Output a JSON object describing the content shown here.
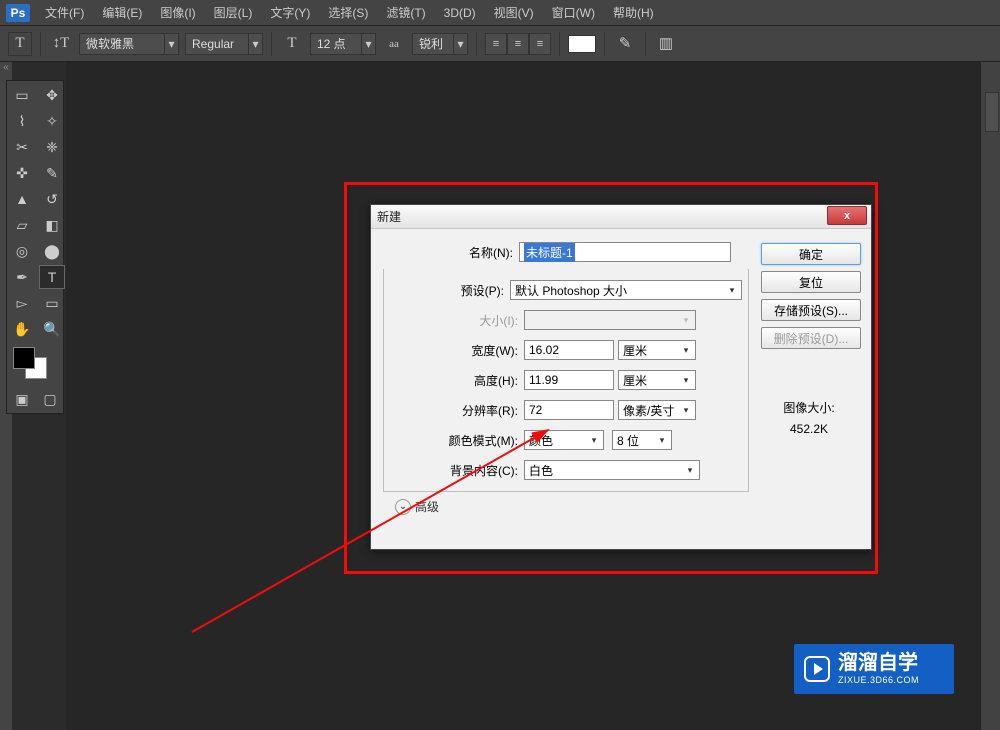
{
  "app": {
    "logo": "Ps"
  },
  "menu": [
    "文件(F)",
    "编辑(E)",
    "图像(I)",
    "图层(L)",
    "文字(Y)",
    "选择(S)",
    "滤镜(T)",
    "3D(D)",
    "视图(V)",
    "窗口(W)",
    "帮助(H)"
  ],
  "options": {
    "font_family": "微软雅黑",
    "font_style": "Regular",
    "font_size": "12 点",
    "aa_label": "aa",
    "aa_value": "锐利"
  },
  "dialog": {
    "title": "新建",
    "close": "x",
    "name_label": "名称(N):",
    "name_value": "未标题-1",
    "preset_label": "预设(P):",
    "preset_value": "默认 Photoshop 大小",
    "size_label": "大小(I):",
    "width_label": "宽度(W):",
    "width_value": "16.02",
    "width_unit": "厘米",
    "height_label": "高度(H):",
    "height_value": "11.99",
    "height_unit": "厘米",
    "res_label": "分辨率(R):",
    "res_value": "72",
    "res_unit": "像素/英寸",
    "mode_label": "颜色模式(M):",
    "mode_value": "颜色",
    "mode_depth": "8 位",
    "bg_label": "背景内容(C):",
    "bg_value": "白色",
    "advanced": "高级",
    "size_heading": "图像大小:",
    "size_value": "452.2K",
    "btn_ok": "确定",
    "btn_reset": "复位",
    "btn_save": "存储预设(S)...",
    "btn_delete": "删除预设(D)..."
  },
  "watermark": {
    "brand": "溜溜自学",
    "url": "ZIXUE.3D66.COM"
  }
}
